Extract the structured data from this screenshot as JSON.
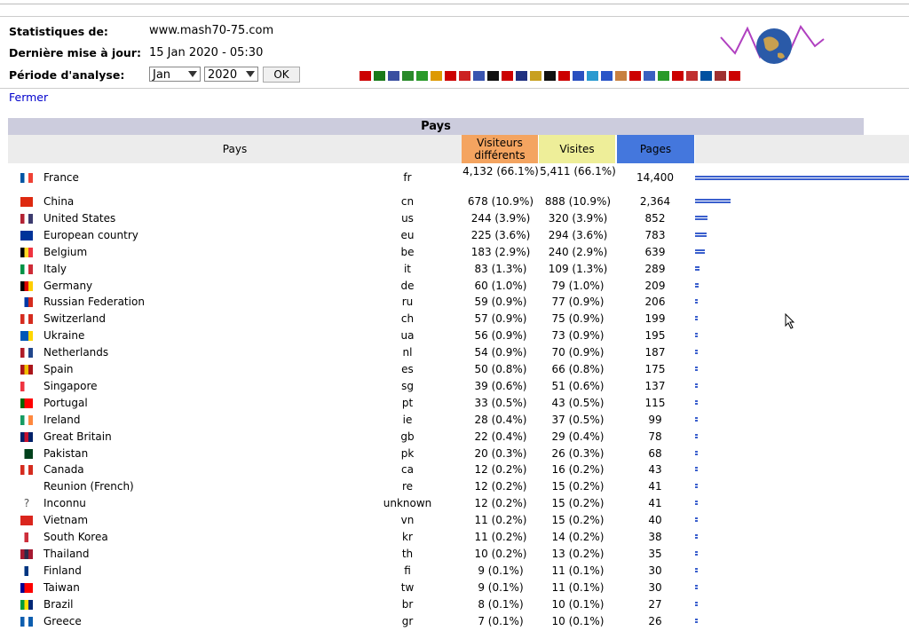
{
  "header": {
    "stats_label": "Statistiques de:",
    "stats_value": "www.mash70-75.com",
    "updated_label": "Dernière mise à jour:",
    "updated_value": "15 Jan 2020 - 05:30",
    "period_label": "Période d'analyse:",
    "month": "Jan",
    "year": "2020",
    "ok_label": "OK"
  },
  "lang_flags": [
    "#c00",
    "#1a7a1a",
    "#3a4fa0",
    "#2a8a2a",
    "#2a9a2a",
    "#d90",
    "#c00",
    "#c22",
    "#3a55b0",
    "#111",
    "#c00",
    "#203080",
    "#c8a020",
    "#111",
    "#c00",
    "#2a50c0",
    "#2a9ad0",
    "#2a55c8",
    "#c88040",
    "#c00",
    "#3a60c0",
    "#2a9a2a",
    "#c00",
    "#c03030",
    "#0050a0",
    "#a03030",
    "#c00"
  ],
  "close_label": "Fermer",
  "table": {
    "title": "Pays",
    "col_country": "Pays",
    "col_unique": "Visiteurs différents",
    "col_visits": "Visites",
    "col_pages": "Pages",
    "rows": [
      {
        "flag": [
          "#0055a4",
          "#fff",
          "#ef4135"
        ],
        "name": "France",
        "code": "fr",
        "unique": "4,132 (66.1%)",
        "visits": "5,411 (66.1%)",
        "pages": "14,400",
        "pct": 1.0
      },
      {
        "flag": [
          "#de2910",
          "#de2910",
          "#de2910"
        ],
        "name": "China",
        "code": "cn",
        "unique": "678 (10.9%)",
        "visits": "888 (10.9%)",
        "pages": "2,364",
        "pct": 0.164
      },
      {
        "flag": [
          "#b22234",
          "#fff",
          "#3c3b6e"
        ],
        "name": "United States",
        "code": "us",
        "unique": "244 (3.9%)",
        "visits": "320 (3.9%)",
        "pages": "852",
        "pct": 0.059
      },
      {
        "flag": [
          "#003399",
          "#003399",
          "#003399"
        ],
        "name": "European country",
        "code": "eu",
        "unique": "225 (3.6%)",
        "visits": "294 (3.6%)",
        "pages": "783",
        "pct": 0.054
      },
      {
        "flag": [
          "#000",
          "#fdda24",
          "#ef3340"
        ],
        "name": "Belgium",
        "code": "be",
        "unique": "183 (2.9%)",
        "visits": "240 (2.9%)",
        "pages": "639",
        "pct": 0.044
      },
      {
        "flag": [
          "#009246",
          "#fff",
          "#ce2b37"
        ],
        "name": "Italy",
        "code": "it",
        "unique": "83 (1.3%)",
        "visits": "109 (1.3%)",
        "pages": "289",
        "pct": 0.02
      },
      {
        "flag": [
          "#000",
          "#dd0000",
          "#ffce00"
        ],
        "name": "Germany",
        "code": "de",
        "unique": "60 (1.0%)",
        "visits": "79 (1.0%)",
        "pages": "209",
        "pct": 0.015
      },
      {
        "flag": [
          "#fff",
          "#0039a6",
          "#d52b1e"
        ],
        "name": "Russian Federation",
        "code": "ru",
        "unique": "59 (0.9%)",
        "visits": "77 (0.9%)",
        "pages": "206",
        "pct": 0.014
      },
      {
        "flag": [
          "#d52b1e",
          "#fff",
          "#d52b1e"
        ],
        "name": "Switzerland",
        "code": "ch",
        "unique": "57 (0.9%)",
        "visits": "75 (0.9%)",
        "pages": "199",
        "pct": 0.014
      },
      {
        "flag": [
          "#0057b7",
          "#0057b7",
          "#ffd700"
        ],
        "name": "Ukraine",
        "code": "ua",
        "unique": "56 (0.9%)",
        "visits": "73 (0.9%)",
        "pages": "195",
        "pct": 0.014
      },
      {
        "flag": [
          "#ae1c28",
          "#fff",
          "#21468b"
        ],
        "name": "Netherlands",
        "code": "nl",
        "unique": "54 (0.9%)",
        "visits": "70 (0.9%)",
        "pages": "187",
        "pct": 0.013
      },
      {
        "flag": [
          "#aa151b",
          "#f1bf00",
          "#aa151b"
        ],
        "name": "Spain",
        "code": "es",
        "unique": "50 (0.8%)",
        "visits": "66 (0.8%)",
        "pages": "175",
        "pct": 0.012
      },
      {
        "flag": [
          "#ef3340",
          "#fff",
          "#fff"
        ],
        "name": "Singapore",
        "code": "sg",
        "unique": "39 (0.6%)",
        "visits": "51 (0.6%)",
        "pages": "137",
        "pct": 0.01
      },
      {
        "flag": [
          "#006600",
          "#ff0000",
          "#ff0000"
        ],
        "name": "Portugal",
        "code": "pt",
        "unique": "33 (0.5%)",
        "visits": "43 (0.5%)",
        "pages": "115",
        "pct": 0.008
      },
      {
        "flag": [
          "#169b62",
          "#fff",
          "#ff883e"
        ],
        "name": "Ireland",
        "code": "ie",
        "unique": "28 (0.4%)",
        "visits": "37 (0.5%)",
        "pages": "99",
        "pct": 0.007
      },
      {
        "flag": [
          "#012169",
          "#c8102e",
          "#012169"
        ],
        "name": "Great Britain",
        "code": "gb",
        "unique": "22 (0.4%)",
        "visits": "29 (0.4%)",
        "pages": "78",
        "pct": 0.005
      },
      {
        "flag": [
          "#fff",
          "#01411c",
          "#01411c"
        ],
        "name": "Pakistan",
        "code": "pk",
        "unique": "20 (0.3%)",
        "visits": "26 (0.3%)",
        "pages": "68",
        "pct": 0.005
      },
      {
        "flag": [
          "#d52b1e",
          "#fff",
          "#d52b1e"
        ],
        "name": "Canada",
        "code": "ca",
        "unique": "12 (0.2%)",
        "visits": "16 (0.2%)",
        "pages": "43",
        "pct": 0.003
      },
      {
        "flag": null,
        "name": "Reunion (French)",
        "code": "re",
        "unique": "12 (0.2%)",
        "visits": "15 (0.2%)",
        "pages": "41",
        "pct": 0.003
      },
      {
        "flag": "?",
        "name": "Inconnu",
        "code": "unknown",
        "unique": "12 (0.2%)",
        "visits": "15 (0.2%)",
        "pages": "41",
        "pct": 0.003
      },
      {
        "flag": [
          "#da251d",
          "#da251d",
          "#da251d"
        ],
        "name": "Vietnam",
        "code": "vn",
        "unique": "11 (0.2%)",
        "visits": "15 (0.2%)",
        "pages": "40",
        "pct": 0.003
      },
      {
        "flag": [
          "#fff",
          "#cd2e3a",
          "#fff"
        ],
        "name": "South Korea",
        "code": "kr",
        "unique": "11 (0.2%)",
        "visits": "14 (0.2%)",
        "pages": "38",
        "pct": 0.003
      },
      {
        "flag": [
          "#a51931",
          "#2d2a4a",
          "#a51931"
        ],
        "name": "Thailand",
        "code": "th",
        "unique": "10 (0.2%)",
        "visits": "13 (0.2%)",
        "pages": "35",
        "pct": 0.002
      },
      {
        "flag": [
          "#fff",
          "#003580",
          "#fff"
        ],
        "name": "Finland",
        "code": "fi",
        "unique": "9 (0.1%)",
        "visits": "11 (0.1%)",
        "pages": "30",
        "pct": 0.002
      },
      {
        "flag": [
          "#000095",
          "#fe0000",
          "#fe0000"
        ],
        "name": "Taiwan",
        "code": "tw",
        "unique": "9 (0.1%)",
        "visits": "11 (0.1%)",
        "pages": "30",
        "pct": 0.002
      },
      {
        "flag": [
          "#009c3b",
          "#ffdf00",
          "#002776"
        ],
        "name": "Brazil",
        "code": "br",
        "unique": "8 (0.1%)",
        "visits": "10 (0.1%)",
        "pages": "27",
        "pct": 0.002
      },
      {
        "flag": [
          "#0d5eaf",
          "#fff",
          "#0d5eaf"
        ],
        "name": "Greece",
        "code": "gr",
        "unique": "7 (0.1%)",
        "visits": "10 (0.1%)",
        "pages": "26",
        "pct": 0.002
      }
    ]
  },
  "colors": {
    "unique_header": "#f4a460",
    "visits_header": "#eeee99",
    "pages_header": "#4477dd",
    "bar": "#3a5fcd",
    "title_bg": "#ccccdd"
  }
}
